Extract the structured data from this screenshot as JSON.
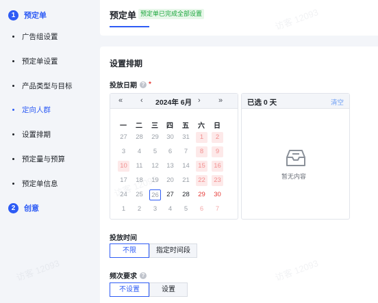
{
  "sidebar": {
    "step1": {
      "num": "1",
      "label": "预定单"
    },
    "items": [
      {
        "label": "广告组设置"
      },
      {
        "label": "预定单设置"
      },
      {
        "label": "产品类型与目标"
      },
      {
        "label": "定向人群"
      },
      {
        "label": "设置排期"
      },
      {
        "label": "预定量与预算"
      },
      {
        "label": "预定单信息"
      }
    ],
    "step2": {
      "num": "2",
      "label": "创意"
    }
  },
  "header": {
    "title": "预定单",
    "badge": "预定单已完成全部设置"
  },
  "schedule": {
    "section_title": "设置排期",
    "date_label": "投放日期",
    "required_mark": "*",
    "help_icon": "?",
    "calendar": {
      "month": "2024年 6月",
      "nav_prev_year": "«",
      "nav_prev_month": "‹",
      "nav_next_month": "›",
      "nav_next_year": "»",
      "weekdays": [
        "一",
        "二",
        "三",
        "四",
        "五",
        "六",
        "日"
      ],
      "weeks": [
        [
          "27",
          "28",
          "29",
          "30",
          "31",
          "1",
          "2"
        ],
        [
          "3",
          "4",
          "5",
          "6",
          "7",
          "8",
          "9"
        ],
        [
          "10",
          "11",
          "12",
          "13",
          "14",
          "15",
          "16"
        ],
        [
          "17",
          "18",
          "19",
          "20",
          "21",
          "22",
          "23"
        ],
        [
          "24",
          "25",
          "26",
          "27",
          "28",
          "29",
          "30"
        ],
        [
          "1",
          "2",
          "3",
          "4",
          "5",
          "6",
          "7"
        ]
      ]
    },
    "selected_panel": {
      "title": "已选 0 天",
      "clear": "清空",
      "empty_icon": "inbox-icon",
      "empty_text": "暂无内容"
    }
  },
  "time": {
    "label": "投放时间",
    "options": [
      "不限",
      "指定时间段"
    ],
    "selected": "不限"
  },
  "frequency": {
    "label": "频次要求",
    "help_icon": "?",
    "options": [
      "不设置",
      "设置"
    ],
    "selected": "不设置"
  },
  "watermark": "访客 12093",
  "colors": {
    "accent": "#2d5bf5",
    "weekend": "#e53935",
    "badge_bg": "#e8f7ea",
    "badge_text": "#18a53a"
  }
}
